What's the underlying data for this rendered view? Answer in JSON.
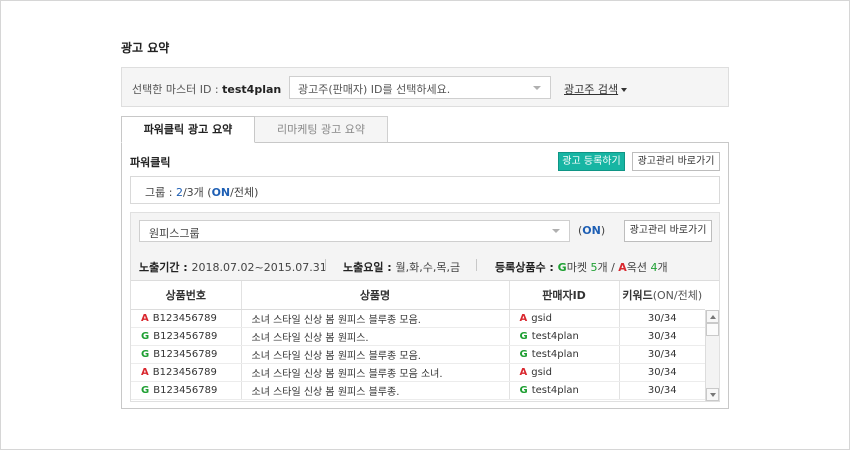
{
  "page": {
    "title": "광고 요약"
  },
  "master": {
    "label": "선택한 마스터 ID : ",
    "id": "test4plan",
    "select_value": "광고주(판매자) ID를 선택하세요.",
    "search_link": "광고주 검색"
  },
  "tabs": [
    {
      "label": "파워클릭 광고 요약"
    },
    {
      "label": "리마케팅 광고 요약"
    }
  ],
  "powerclick": {
    "title": "파워클릭",
    "register_button": "광고 등록하기",
    "manage_button": "광고관리 바로가기",
    "group_summary": {
      "label": "그룹 : ",
      "on_count": "2",
      "total_text": "/3개 (",
      "on_text": "ON",
      "tail_text": "/전체)"
    }
  },
  "group_panel": {
    "select_value": "원피스그룹",
    "status_open": "(",
    "status": "ON",
    "status_close": ")",
    "manage_button": "광고관리 바로가기",
    "period_label": "노출기간 : ",
    "period_value": "2018.07.02~2015.07.31",
    "days_label": "노출요일 : ",
    "days_value": "월,화,수,목,금",
    "items_label": "등록상품수 : ",
    "gmarket_mark": "G",
    "gmarket_text": "마켓 ",
    "gmarket_count": "5",
    "gmarket_unit": "개 / ",
    "auction_mark": "A",
    "auction_text": "옥션 ",
    "auction_count": "4",
    "auction_unit": "개"
  },
  "table": {
    "headers": {
      "product_no": "상품번호",
      "product_name": "상품명",
      "seller_id": "판매자ID",
      "keyword": "키워드",
      "keyword_sub": "(ON/전체)"
    },
    "rows": [
      {
        "mark": "A",
        "product_no": "B123456789",
        "name": "소녀 스타일 신상 봄 원피스 블루종 모음.",
        "seller_mark": "A",
        "seller": "gsid",
        "keyword": "30/34"
      },
      {
        "mark": "G",
        "product_no": "B123456789",
        "name": "소녀 스타일 신상 봄 원피스.",
        "seller_mark": "G",
        "seller": "test4plan",
        "keyword": "30/34"
      },
      {
        "mark": "G",
        "product_no": "B123456789",
        "name": "소녀 스타일 신상 봄 원피스 블루종 모음.",
        "seller_mark": "G",
        "seller": "test4plan",
        "keyword": "30/34"
      },
      {
        "mark": "A",
        "product_no": "B123456789",
        "name": "소녀 스타일 신상 봄 원피스 블루종 모음 소녀.",
        "seller_mark": "A",
        "seller": "gsid",
        "keyword": "30/34"
      },
      {
        "mark": "G",
        "product_no": "B123456789",
        "name": "소녀 스타일 신상 봄 원피스 블루종.",
        "seller_mark": "G",
        "seller": "test4plan",
        "keyword": "30/34"
      }
    ]
  },
  "icons": {
    "dropdown": "chevron-down-icon",
    "scroll_up": "arrow-up-icon",
    "scroll_down": "arrow-down-icon"
  },
  "colors": {
    "primary_button": "#17b5a3",
    "on_blue": "#1e5fb4",
    "gmarket_green": "#1e9f32",
    "auction_red": "#d9272e"
  }
}
